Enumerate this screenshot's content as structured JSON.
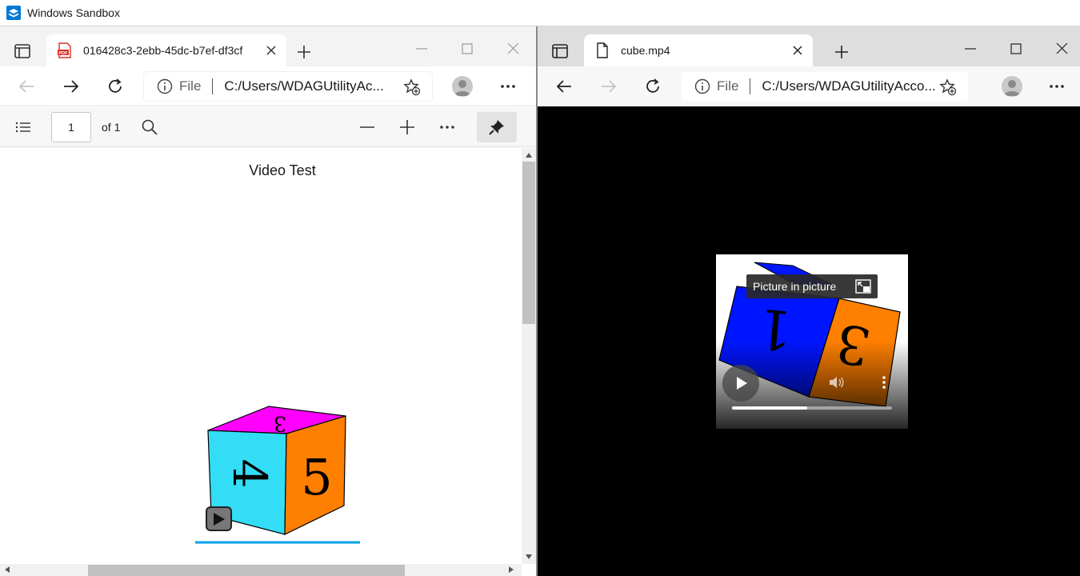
{
  "window": {
    "title": "Windows Sandbox"
  },
  "left_browser": {
    "tab": {
      "title": "016428c3-2ebb-45dc-b7ef-df3cf",
      "favicon": "pdf-icon"
    },
    "address": {
      "scheme": "File",
      "url": "C:/Users/WDAGUtilityAc..."
    },
    "pdf_toolbar": {
      "page_value": "1",
      "page_of": "of 1"
    },
    "document": {
      "title": "Video Test"
    }
  },
  "right_browser": {
    "tab": {
      "title": "cube.mp4",
      "favicon": "file-icon"
    },
    "address": {
      "scheme": "File",
      "url": "C:/Users/WDAGUtilityAcco..."
    },
    "video": {
      "tooltip": "Picture in picture",
      "progress_fraction": 0.47
    }
  },
  "colors": {
    "accent": "#0078d4",
    "pdf_red": "#d93025",
    "cube_magenta": "#ff00ff",
    "cube_cyan": "#33ddf5",
    "cube_orange": "#ff7f00",
    "cube_blue": "#0015ff"
  }
}
